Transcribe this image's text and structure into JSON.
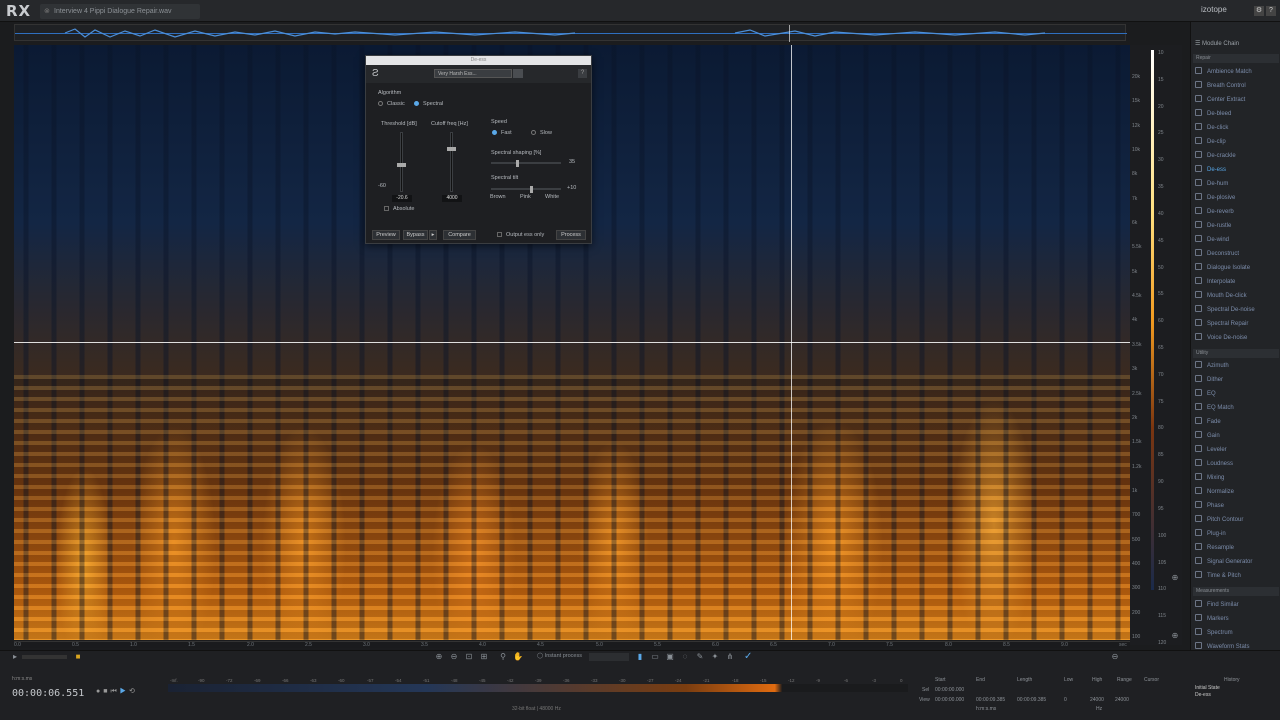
{
  "app": {
    "logo": "RX",
    "brand": "izotope",
    "file_tab": "Interview 4 Pippi Dialogue Repair.wav"
  },
  "overview": {
    "label": "waveform-overview"
  },
  "deesser": {
    "title": "De-ess",
    "preset": "Very Harsh Ess...",
    "help": "?",
    "algorithm_label": "Algorithm",
    "classic": "Classic",
    "spectral": "Spectral",
    "threshold_label": "Threshold [dB]",
    "cutoff_label": "Cutoff freq [Hz]",
    "threshold_min": "-60",
    "threshold_value": "-20.6",
    "cutoff_value": "4000",
    "absolute": "Absolute",
    "speed_label": "Speed",
    "fast": "Fast",
    "slow": "Slow",
    "shaping_label": "Spectral shaping [%]",
    "shaping_value": "35",
    "tilt_label": "Spectral tilt",
    "tilt_value": "+10",
    "brown": "Brown",
    "pink": "Pink",
    "white": "White",
    "preview": "Preview",
    "bypass": "Bypass",
    "compare": "Compare",
    "output_ess": "Output ess only",
    "process": "Process"
  },
  "freq_ticks": [
    "20k",
    "15k",
    "12k",
    "10k",
    "8k",
    "7k",
    "6k",
    "5.5k",
    "5k",
    "4.5k",
    "4k",
    "3.5k",
    "3k",
    "2.5k",
    "2k",
    "1.5k",
    "1.2k",
    "1k",
    "700",
    "500",
    "400",
    "300",
    "200",
    "100"
  ],
  "db_ticks": [
    "10",
    "15",
    "20",
    "25",
    "30",
    "35",
    "40",
    "45",
    "50",
    "55",
    "60",
    "65",
    "70",
    "75",
    "80",
    "85",
    "90",
    "95",
    "100",
    "105",
    "110",
    "115",
    "120"
  ],
  "time_ticks": [
    "0.0",
    "0.5",
    "1.0",
    "1.5",
    "2.0",
    "2.5",
    "3.0",
    "3.5",
    "4.0",
    "4.5",
    "5.0",
    "5.5",
    "6.0",
    "6.5",
    "7.0",
    "7.5",
    "8.0",
    "8.5",
    "9.0",
    "sec"
  ],
  "panel": {
    "module_chain": "Module Chain",
    "repair_head": "Repair",
    "repair": [
      "Ambience Match",
      "Breath Control",
      "Center Extract",
      "De-bleed",
      "De-click",
      "De-clip",
      "De-crackle",
      "De-ess",
      "De-hum",
      "De-plosive",
      "De-reverb",
      "De-rustle",
      "De-wind",
      "Deconstruct",
      "Dialogue Isolate",
      "Interpolate",
      "Mouth De-click",
      "Spectral De-noise",
      "Spectral Repair",
      "Voice De-noise"
    ],
    "active": "De-ess",
    "utility_head": "Utility",
    "utility": [
      "Azimuth",
      "Dither",
      "EQ",
      "EQ Match",
      "Fade",
      "Gain",
      "Leveler",
      "Loudness",
      "Mixing",
      "Normalize",
      "Phase",
      "Pitch Contour",
      "Plug-in",
      "Resample",
      "Signal Generator",
      "Time & Pitch"
    ],
    "measure_head": "Measurements",
    "measure": [
      "Find Similar",
      "Markers",
      "Spectrum",
      "Waveform Stats"
    ]
  },
  "transport": {
    "tc_label": "h:m:s.ms",
    "timecode": "00:00:06.551",
    "instant": "Instant process"
  },
  "meter_scale": [
    "-Inf.",
    "-90",
    "-72",
    "-69",
    "-66",
    "-63",
    "-60",
    "-57",
    "-54",
    "-51",
    "-48",
    "-45",
    "-42",
    "-39",
    "-36",
    "-33",
    "-30",
    "-27",
    "-24",
    "-21",
    "-18",
    "-15",
    "-12",
    "-9",
    "-6",
    "-3",
    "0"
  ],
  "format": "32-bit float | 48000 Hz",
  "selection": {
    "start": "Start",
    "end": "End",
    "length": "Length",
    "low": "Low",
    "high": "High",
    "range": "Range",
    "cursor": "Cursor",
    "sel_label": "Sel",
    "view_label": "View",
    "sel_start": "00:00:00.000",
    "view_start": "00:00:00.000",
    "view_end": "00:00:09.385",
    "view_length": "00:00:09.385",
    "low_val": "0",
    "high_val": "24000",
    "range_val": "24000",
    "units": "h:m:s.ms",
    "hz": "Hz"
  },
  "history": {
    "title": "History",
    "initial": "Initial State",
    "item": "De-ess"
  }
}
